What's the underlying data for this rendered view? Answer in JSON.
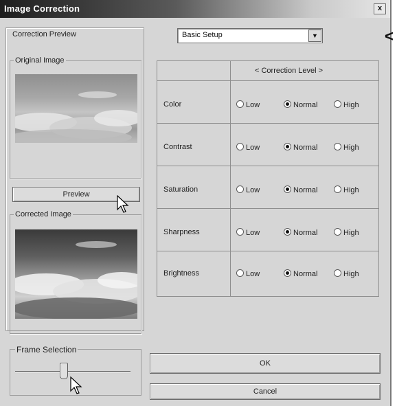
{
  "window": {
    "title": "Image Correction",
    "close_label": "x"
  },
  "left_panel": {
    "preview_heading": "Correction Preview",
    "original_label": "Original Image",
    "preview_button": "Preview",
    "corrected_label": "Corrected Image",
    "frame_selection_label": "Frame Selection",
    "frame_slider_value": 0.42
  },
  "right_panel": {
    "preset_dropdown": {
      "selected": "Basic Setup"
    },
    "table_header": "< Correction Level >",
    "level_labels": {
      "low": "Low",
      "normal": "Normal",
      "high": "High"
    },
    "rows": [
      {
        "label": "Color",
        "selected": "Normal"
      },
      {
        "label": "Contrast",
        "selected": "Normal"
      },
      {
        "label": "Saturation",
        "selected": "Normal"
      },
      {
        "label": "Sharpness",
        "selected": "Normal"
      },
      {
        "label": "Brightness",
        "selected": "Normal"
      }
    ],
    "ok_button": "OK",
    "cancel_button": "Cancel"
  },
  "annotation_mark": "<"
}
